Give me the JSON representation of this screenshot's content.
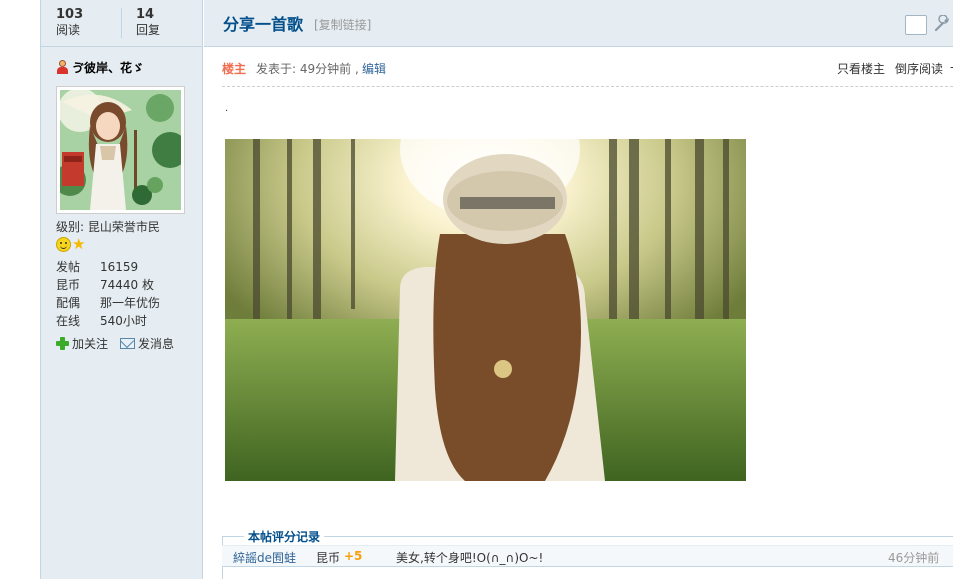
{
  "stats": {
    "views_count": "103",
    "views_label": "阅读",
    "replies_count": "14",
    "replies_label": "回复"
  },
  "author": {
    "name": "ゔ彼岸、花ゞ",
    "avatar_icon": "avatar-girl-umbrella",
    "level_label": "级别:",
    "level_value": "昆山荣誉市民",
    "badges": [
      "smiley-icon",
      "star-icon"
    ],
    "profile": [
      {
        "key": "发帖",
        "value": "16159"
      },
      {
        "key": "昆币",
        "value": "74440 枚"
      },
      {
        "key": "配偶",
        "value": "那一年优伤"
      },
      {
        "key": "在线",
        "value": "540小时"
      }
    ],
    "follow_label": "加关注",
    "message_label": "发消息"
  },
  "thread": {
    "title": "分享一首歌",
    "copy_link": "[复制链接]"
  },
  "post": {
    "op_label": "楼主",
    "posted_at": "发表于: 49分钟前 ,",
    "edit_label": "编辑",
    "only_author_label": "只看楼主",
    "reverse_label": "倒序阅读",
    "more_arrow": "-",
    "content_text": ".",
    "image_icon": "photo-girl-hat-forest"
  },
  "rating": {
    "title": "本帖评分记录",
    "records": [
      {
        "user": "綷謡de囿蛙",
        "currency": "昆币",
        "score": "+5",
        "reason": "美女,转个身吧!O(∩_∩)O~!",
        "time": "46分钟前"
      }
    ]
  },
  "colors": {
    "sidebar_bg": "#e5edf2",
    "border": "#c2d5e3",
    "title_blue": "#024f8c",
    "op_orange": "#f26c4f",
    "score_orange": "#f99e0c"
  }
}
